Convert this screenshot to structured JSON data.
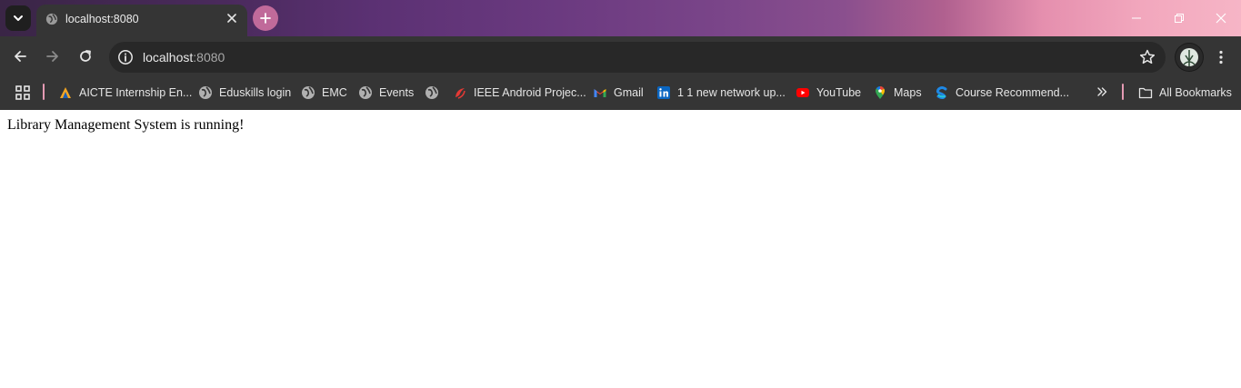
{
  "tab": {
    "title": "localhost:8080"
  },
  "address": {
    "host": "localhost",
    "port": ":8080"
  },
  "bookmarks": {
    "items": [
      {
        "label": "AICTE Internship En...",
        "icon": "aicte-icon"
      },
      {
        "label": "Eduskills login",
        "icon": "globe-icon"
      },
      {
        "label": "EMC",
        "icon": "globe-icon"
      },
      {
        "label": "Events",
        "icon": "globe-icon"
      },
      {
        "label": "",
        "icon": "globe-icon"
      },
      {
        "label": "IEEE Android Projec...",
        "icon": "ieee-icon"
      },
      {
        "label": "Gmail",
        "icon": "gmail-icon"
      },
      {
        "label": "1 1 new network up...",
        "icon": "linkedin-icon"
      },
      {
        "label": "YouTube",
        "icon": "youtube-icon"
      },
      {
        "label": "Maps",
        "icon": "maps-icon"
      },
      {
        "label": "Course Recommend...",
        "icon": "course-icon"
      }
    ],
    "all_label": "All Bookmarks"
  },
  "page": {
    "text": "Library Management System is running!"
  }
}
